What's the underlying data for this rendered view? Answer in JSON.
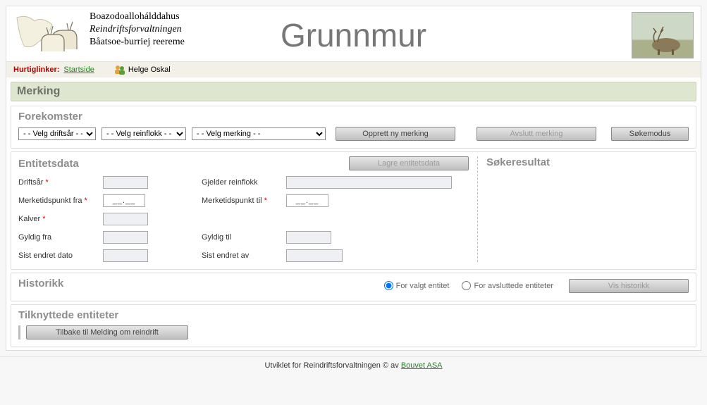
{
  "header": {
    "org_line1": "Boazodoallohálddahus",
    "org_line2": "Reindriftsforvaltningen",
    "org_line3": "Båatsoe-burriej reereme",
    "app_title": "Grunnmur"
  },
  "quicklinks": {
    "label": "Hurtiglinker:",
    "startside": "Startside",
    "user_name": "Helge Oskal"
  },
  "section_bar": "Merking",
  "forekomster": {
    "title": "Forekomster",
    "select_driftsaar": "- - Velg driftsår - -",
    "select_reinflokk": "- - Velg reinflokk - -",
    "select_merking": "- - Velg merking - -",
    "btn_opprett": "Opprett ny merking",
    "btn_avslutt": "Avslutt merking",
    "btn_sokemodus": "Søkemodus"
  },
  "entitetsdata": {
    "title": "Entitetsdata",
    "btn_lagre": "Lagre entitetsdata",
    "sokeresultat_title": "Søkeresultat",
    "labels": {
      "driftsaar": "Driftsår",
      "gjelder_reinflokk": "Gjelder reinflokk",
      "merketidspunkt_fra": "Merketidspunkt fra",
      "merketidspunkt_til": "Merketidspunkt til",
      "kalver": "Kalver",
      "gyldig_fra": "Gyldig fra",
      "gyldig_til": "Gyldig til",
      "sist_endret_dato": "Sist endret dato",
      "sist_endret_av": "Sist endret av"
    },
    "date_placeholder": "__.__"
  },
  "historikk": {
    "title": "Historikk",
    "radio_valgt": "For valgt entitet",
    "radio_avsluttede": "For avsluttede entiteter",
    "btn_vis": "Vis historikk"
  },
  "tilknyttede": {
    "title": "Tilknyttede entiteter",
    "btn_tilbake": "Tilbake til Melding om reindrift"
  },
  "footer": {
    "text_prefix": "Utviklet for Reindriftsforvaltningen © av ",
    "link": "Bouvet ASA"
  }
}
